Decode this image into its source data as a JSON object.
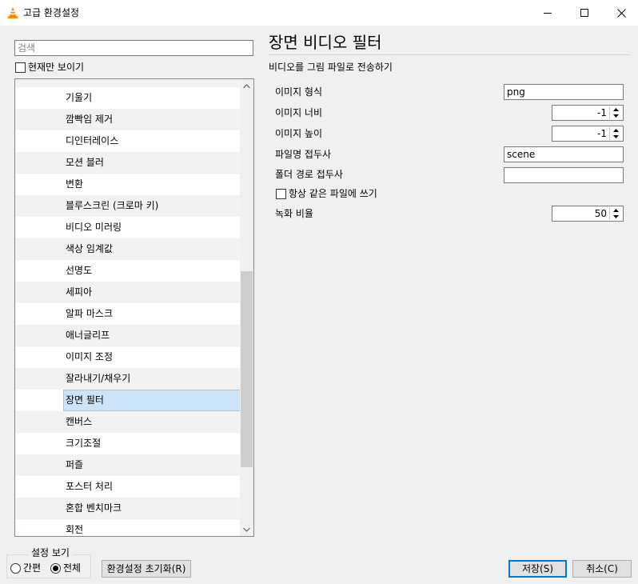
{
  "window": {
    "title": "고급 환경설정"
  },
  "sidebar": {
    "search_placeholder": "검색",
    "show_current_only_label": "현재만 보이기",
    "tree_items": [
      {
        "label": "기울기"
      },
      {
        "label": "깜빡임 제거"
      },
      {
        "label": "디인터레이스"
      },
      {
        "label": "모션 블러"
      },
      {
        "label": "변환"
      },
      {
        "label": "블루스크린 (크로마 키)"
      },
      {
        "label": "비디오 미러링"
      },
      {
        "label": "색상 임계값"
      },
      {
        "label": "선명도"
      },
      {
        "label": "세피아"
      },
      {
        "label": "알파 마스크"
      },
      {
        "label": "애너글리프"
      },
      {
        "label": "이미지 조정"
      },
      {
        "label": "잘라내기/채우기"
      },
      {
        "label": "장면 필터",
        "selected": true
      },
      {
        "label": "캔버스"
      },
      {
        "label": "크기조절"
      },
      {
        "label": "퍼즐"
      },
      {
        "label": "포스터 처리"
      },
      {
        "label": "혼합 벤치마크"
      },
      {
        "label": "회전"
      }
    ]
  },
  "main": {
    "title": "장면 비디오 필터",
    "subtitle": "비디오를 그림 파일로 전송하기",
    "fields": {
      "image_format": {
        "label": "이미지 형식",
        "value": "png"
      },
      "image_width": {
        "label": "이미지 너비",
        "value": "-1"
      },
      "image_height": {
        "label": "이미지 높이",
        "value": "-1"
      },
      "filename_prefix": {
        "label": "파일명 접두사",
        "value": "scene"
      },
      "folder_prefix": {
        "label": "폴더 경로 접두사",
        "value": ""
      },
      "always_overwrite": {
        "label": "항상 같은 파일에 쓰기",
        "checked": false
      },
      "recording_ratio": {
        "label": "녹화 비율",
        "value": "50"
      }
    }
  },
  "footer": {
    "view_settings_title": "설정 보기",
    "simple_label": "간편",
    "all_label": "전체",
    "selected_view": "all",
    "reset_button": "환경설정 초기화(R)",
    "save_button": "저장(S)",
    "cancel_button": "취소(C)"
  },
  "colors": {
    "selection_fill": "#cce4f7",
    "selection_border": "#99c9ef",
    "default_button_border": "#0078d7",
    "vlc_cone_orange": "#f28c00"
  },
  "icons": [
    "vlc-cone-icon",
    "minimize-icon",
    "maximize-icon",
    "close-icon",
    "scroll-up-icon",
    "scroll-down-icon",
    "spin-up-icon",
    "spin-down-icon"
  ]
}
